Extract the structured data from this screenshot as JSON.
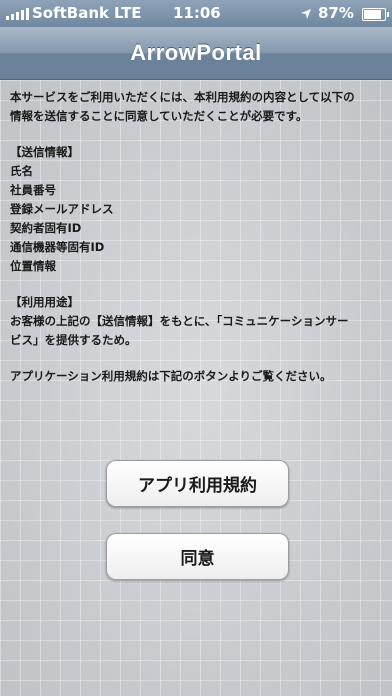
{
  "status_bar": {
    "carrier": "SoftBank",
    "network": "LTE",
    "time": "11:06",
    "battery": "87%",
    "battery_level": 0.87
  },
  "navbar": {
    "title": "ArrowPortal"
  },
  "body": {
    "intro": [
      "本サービスをご利用いただくには、本利用規約の内容として以下の",
      "情報を送信することに同意していただくことが必要です。"
    ],
    "info_heading": "【送信情報】",
    "info_items": [
      "氏名",
      "社員番号",
      "登録メールアドレス",
      "契約者固有ID",
      "通信機器等固有ID",
      "位置情報"
    ],
    "purpose_heading": "【利用用途】",
    "purpose_lines": [
      "お客様の上記の【送信情報】をもとに、「コミュニケーションサー",
      "ビス」を提供するため。"
    ],
    "footer_note": "アプリケーション利用規約は下記のボタンよりご覧ください。"
  },
  "buttons": {
    "terms_label": "アプリ利用規約",
    "agree_label": "同意"
  }
}
